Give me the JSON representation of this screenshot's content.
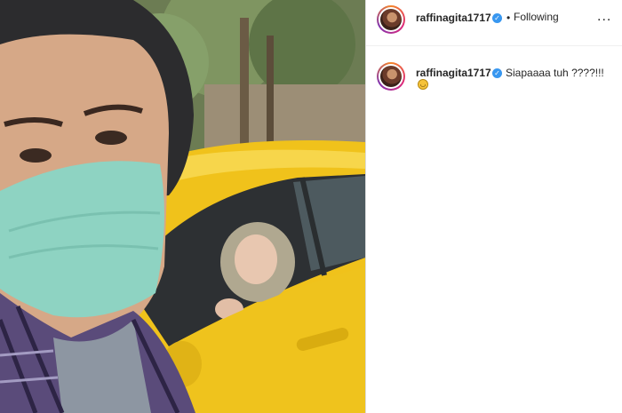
{
  "post": {
    "username": "raffinagita1717",
    "verified": true,
    "separator": "•",
    "follow_status": "Following",
    "more_label": "...",
    "avatar_icon": "profile-avatar"
  },
  "comment": {
    "username": "raffinagita1717",
    "verified": true,
    "text": "Siapaaaa tuh ????!!!",
    "emoji": "grinning-squinting-face-emoji"
  },
  "colors": {
    "accent_blue": "#3897f0",
    "text": "#262626",
    "taxi_yellow": "#f2c51d",
    "mask_green": "#8ed3c2"
  },
  "media": {
    "type": "video",
    "scene": "taxi-selfie"
  }
}
